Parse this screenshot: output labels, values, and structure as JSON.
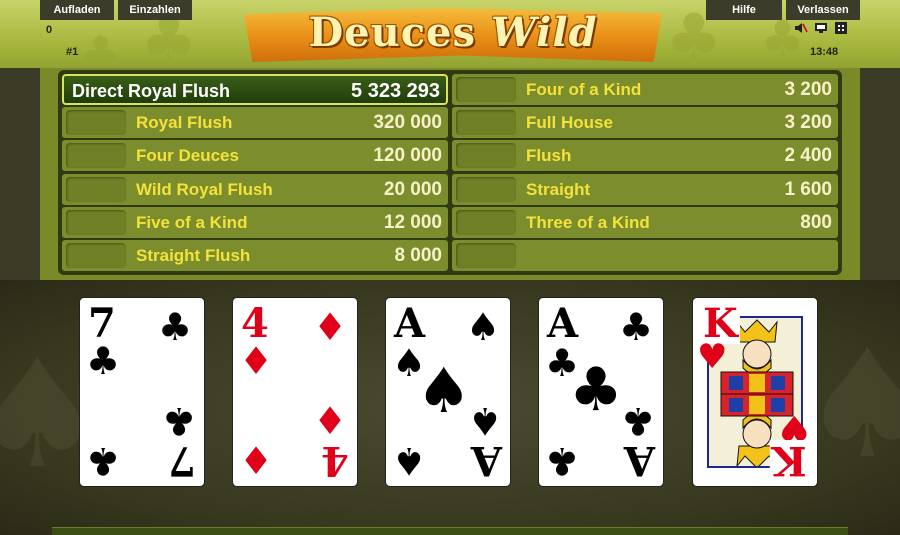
{
  "menu": {
    "top_up": "Aufladen",
    "deposit": "Einzahlen",
    "help": "Hilfe",
    "leave": "Verlassen"
  },
  "status": {
    "balance": "0",
    "table_number": "#1",
    "clock": "13:48"
  },
  "game": {
    "title_part1": "Deuces",
    "title_part2": "Wild"
  },
  "paytable": {
    "left": [
      {
        "hand": "Direct Royal Flush",
        "amount": "5 323 293",
        "highlight": true
      },
      {
        "hand": "Royal Flush",
        "amount": "320 000"
      },
      {
        "hand": "Four Deuces",
        "amount": "120 000"
      },
      {
        "hand": "Wild Royal Flush",
        "amount": "20 000"
      },
      {
        "hand": "Five of a Kind",
        "amount": "12 000"
      },
      {
        "hand": "Straight Flush",
        "amount": "8 000"
      }
    ],
    "right": [
      {
        "hand": "Four of a Kind",
        "amount": "3 200"
      },
      {
        "hand": "Full House",
        "amount": "3 200"
      },
      {
        "hand": "Flush",
        "amount": "2 400"
      },
      {
        "hand": "Straight",
        "amount": "1 600"
      },
      {
        "hand": "Three of a Kind",
        "amount": "800"
      },
      {
        "hand": "",
        "amount": ""
      }
    ]
  },
  "cards": [
    {
      "rank": "7",
      "suit": "clubs",
      "symbol": "♣",
      "color": "#000000"
    },
    {
      "rank": "4",
      "suit": "diamonds",
      "symbol": "♦",
      "color": "#e0001a"
    },
    {
      "rank": "A",
      "suit": "spades",
      "symbol": "♠",
      "color": "#000000"
    },
    {
      "rank": "A",
      "suit": "clubs",
      "symbol": "♣",
      "color": "#000000"
    },
    {
      "rank": "K",
      "suit": "hearts",
      "symbol": "♥",
      "color": "#e0001a"
    }
  ],
  "icons": {
    "sound": "sound-muted-icon",
    "screen": "display-icon",
    "fullscreen": "fullscreen-icon"
  },
  "colors": {
    "hand_text": "#f3e23a",
    "amount_text": "#f6f1c8",
    "highlight_bg": "#2c4a12"
  }
}
